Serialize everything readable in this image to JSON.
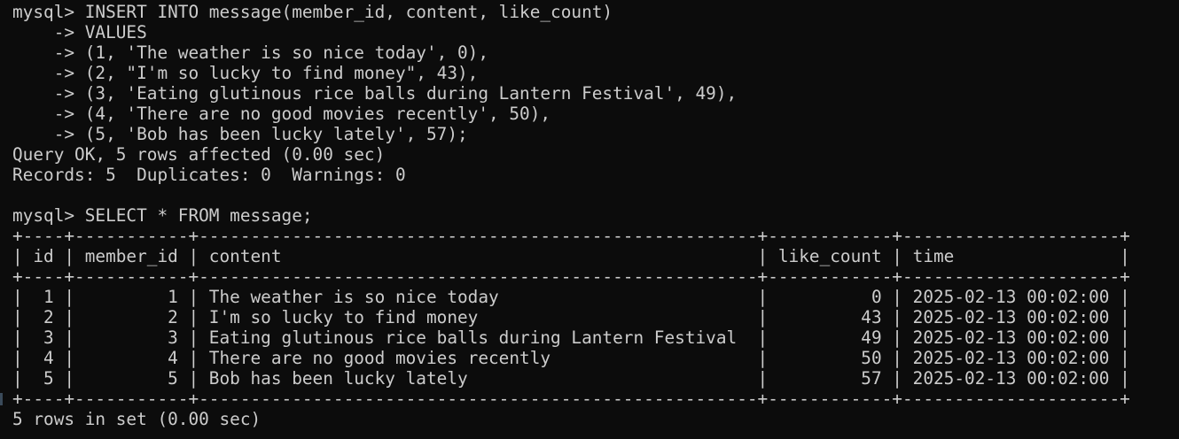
{
  "terminal": {
    "insert_block": [
      "mysql> INSERT INTO message(member_id, content, like_count)",
      "    -> VALUES",
      "    -> (1, 'The weather is so nice today', 0),",
      "    -> (2, \"I'm so lucky to find money\", 43),",
      "    -> (3, 'Eating glutinous rice balls during Lantern Festival', 49),",
      "    -> (4, 'There are no good movies recently', 50),",
      "    -> (5, 'Bob has been lucky lately', 57);",
      "Query OK, 5 rows affected (0.00 sec)",
      "Records: 5  Duplicates: 0  Warnings: 0",
      "",
      "mysql> SELECT * FROM message;"
    ],
    "table": {
      "border": "+----+-----------+------------------------------------------------------+------------+---------------------+",
      "header": "| id | member_id | content                                              | like_count | time                |",
      "columns": [
        "id",
        "member_id",
        "content",
        "like_count",
        "time"
      ],
      "rows": [
        "|  1 |         1 | The weather is so nice today                         |          0 | 2025-02-13 00:02:00 |",
        "|  2 |         2 | I'm so lucky to find money                           |         43 | 2025-02-13 00:02:00 |",
        "|  3 |         3 | Eating glutinous rice balls during Lantern Festival  |         49 | 2025-02-13 00:02:00 |",
        "|  4 |         4 | There are no good movies recently                    |         50 | 2025-02-13 00:02:00 |",
        "|  5 |         5 | Bob has been lucky lately                            |         57 | 2025-02-13 00:02:00 |"
      ]
    },
    "footer": "5 rows in set (0.00 sec)",
    "colors": {
      "background": "#0c0c0c",
      "text": "#cccccc"
    }
  }
}
